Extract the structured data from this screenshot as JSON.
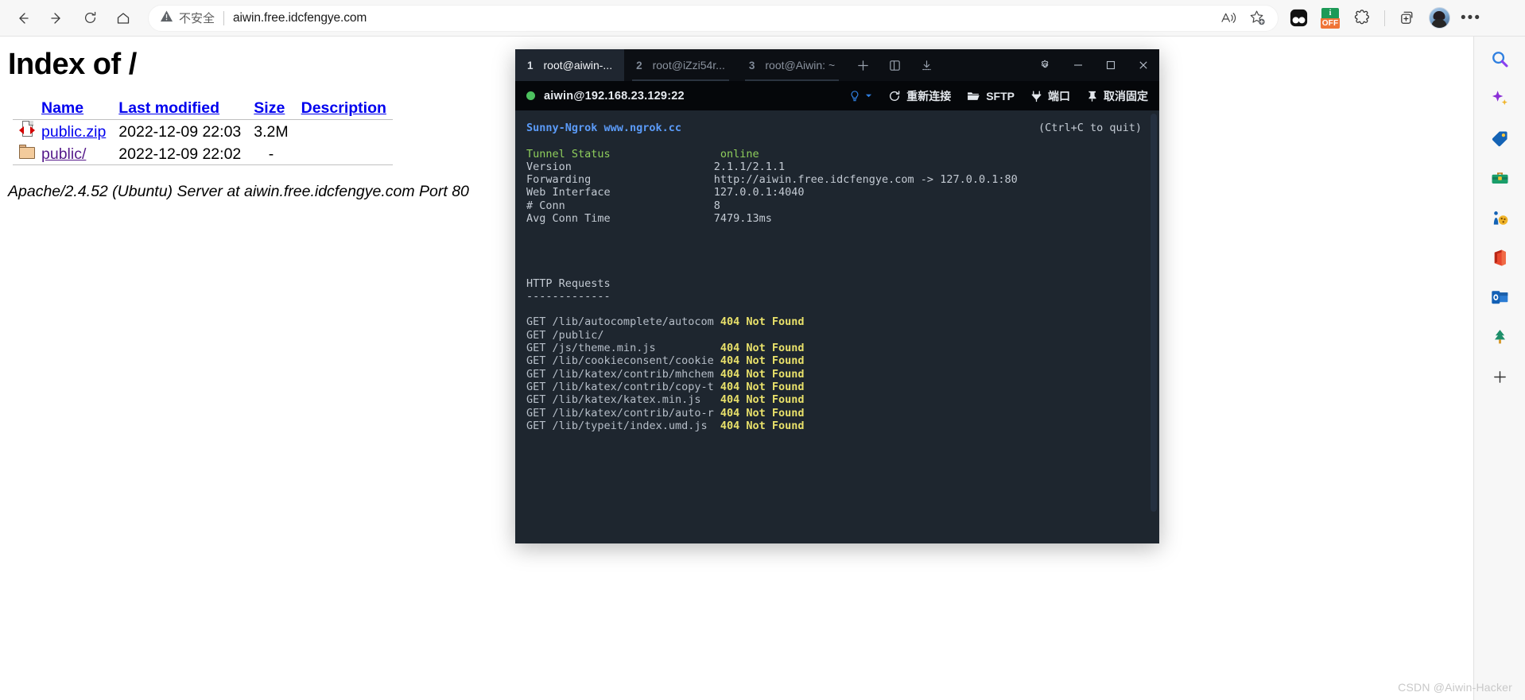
{
  "browser": {
    "nav": {
      "back_label": "Back",
      "forward_label": "Forward",
      "refresh_label": "Refresh",
      "home_label": "Home"
    },
    "omnibox": {
      "security_label": "不安全",
      "url": "aiwin.free.idcfengye.com",
      "read_aloud_label": "Read aloud",
      "favorite_label": "Add to favorites"
    },
    "extensions": [
      {
        "name": "dark-reader-extension",
        "label": "Dark Reader"
      },
      {
        "name": "adblock-off-extension",
        "label": "OFF",
        "badge_top": "i",
        "colors": {
          "top": "#1d9a57",
          "bottom": "#ef7436"
        }
      },
      {
        "name": "extensions-puzzle",
        "label": "Extensions"
      }
    ],
    "collections_label": "Collections",
    "profile_label": "Profile",
    "settings_more_label": "Settings and more"
  },
  "sidebar": {
    "items": [
      {
        "name": "search-icon",
        "label": "Search"
      },
      {
        "name": "copilot-sparkle-icon",
        "label": "Copilot"
      },
      {
        "name": "shopping-tag-icon",
        "label": "Shopping"
      },
      {
        "name": "briefcase-tools-icon",
        "label": "Tools"
      },
      {
        "name": "games-icon",
        "label": "Games"
      },
      {
        "name": "office-icon",
        "label": "Office"
      },
      {
        "name": "outlook-icon",
        "label": "Outlook"
      },
      {
        "name": "drop-tree-icon",
        "label": "Drop"
      },
      {
        "name": "add-sidebar-icon",
        "label": "Customize"
      }
    ]
  },
  "page": {
    "title": "Index of /",
    "columns": [
      "Name",
      "Last modified",
      "Size",
      "Description"
    ],
    "rows": [
      {
        "icon": "zip-file-icon",
        "name": "public.zip",
        "modified": "2022-12-09 22:03",
        "size": "3.2M",
        "description": ""
      },
      {
        "icon": "folder-icon",
        "name": "public/",
        "modified": "2022-12-09 22:02",
        "size": "-",
        "description": ""
      }
    ],
    "footer": "Apache/2.4.52 (Ubuntu) Server at aiwin.free.idcfengye.com Port 80"
  },
  "terminal": {
    "tabs": [
      {
        "num": "1",
        "label": "root@aiwin-...",
        "active": true
      },
      {
        "num": "2",
        "label": "root@iZzi54r...",
        "active": false
      },
      {
        "num": "3",
        "label": "root@Aiwin: ~",
        "active": false
      }
    ],
    "tab_controls": [
      {
        "name": "new-tab-icon",
        "label": "New tab"
      },
      {
        "name": "split-pane-icon",
        "label": "Split pane"
      },
      {
        "name": "download-icon",
        "label": "Downloads"
      }
    ],
    "window_controls": [
      {
        "name": "settings-gear-icon",
        "label": "Settings"
      },
      {
        "name": "minimize-icon",
        "label": "Minimize"
      },
      {
        "name": "maximize-icon",
        "label": "Maximize"
      },
      {
        "name": "close-icon",
        "label": "Close"
      }
    ],
    "connection": {
      "status_color": "#4cc15e",
      "host": "aiwin@192.168.23.129:22"
    },
    "toolbar": [
      {
        "name": "hint-bulb-button",
        "label": ""
      },
      {
        "name": "reconnect-button",
        "label": "重新连接"
      },
      {
        "name": "sftp-button",
        "label": "SFTP"
      },
      {
        "name": "ports-button",
        "label": "端口"
      },
      {
        "name": "unpin-button",
        "label": "取消固定"
      }
    ],
    "output": {
      "header": "Sunny-Ngrok www.ngrok.cc",
      "ctrl_hint": "(Ctrl+C to quit)",
      "status_rows": [
        {
          "key": "Tunnel Status",
          "value": "online",
          "value_color": "green"
        },
        {
          "key": "Version",
          "value": "2.1.1/2.1.1",
          "value_color": "grey"
        },
        {
          "key": "Forwarding",
          "value": "http://aiwin.free.idcfengye.com -> 127.0.0.1:80",
          "value_color": "grey"
        },
        {
          "key": "Web Interface",
          "value": "127.0.0.1:4040",
          "value_color": "grey"
        },
        {
          "key": "# Conn",
          "value": "8",
          "value_color": "grey"
        },
        {
          "key": "Avg Conn Time",
          "value": "7479.13ms",
          "value_color": "grey"
        }
      ],
      "requests_title": "HTTP Requests",
      "requests_rule": "-------------",
      "requests": [
        {
          "method": "GET",
          "path": "/lib/autocomplete/autocom",
          "status": "404 Not Found"
        },
        {
          "method": "GET",
          "path": "/public/",
          "status": ""
        },
        {
          "method": "GET",
          "path": "/js/theme.min.js",
          "status": "404 Not Found"
        },
        {
          "method": "GET",
          "path": "/lib/cookieconsent/cookie",
          "status": "404 Not Found"
        },
        {
          "method": "GET",
          "path": "/lib/katex/contrib/mhchem",
          "status": "404 Not Found"
        },
        {
          "method": "GET",
          "path": "/lib/katex/contrib/copy-t",
          "status": "404 Not Found"
        },
        {
          "method": "GET",
          "path": "/lib/katex/katex.min.js",
          "status": "404 Not Found"
        },
        {
          "method": "GET",
          "path": "/lib/katex/contrib/auto-r",
          "status": "404 Not Found"
        },
        {
          "method": "GET",
          "path": "/lib/typeit/index.umd.js",
          "status": "404 Not Found"
        }
      ]
    }
  },
  "watermark": "CSDN @Aiwin-Hacker"
}
